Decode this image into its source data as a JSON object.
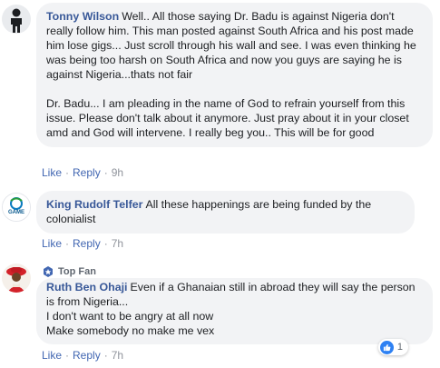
{
  "comments": [
    {
      "author": "Tonny Wilson",
      "paragraphs": [
        "Well.. All those saying Dr. Badu is against Nigeria don't really follow him. This man posted against South Africa and his post made him lose gigs... Just scroll through his wall and see. I was even thinking he was being too harsh on South Africa and now you guys are saying he is against Nigeria...thats not fair",
        "Dr. Badu... I am pleading in the name of God to refrain yourself from this issue. Please don't talk about it anymore. Just pray about it in your closet amd and God will intervene. I really beg you.. This will be for good"
      ],
      "like_label": "Like",
      "reply_label": "Reply",
      "time": "9h"
    },
    {
      "author": "King Rudolf Telfer",
      "paragraphs": [
        "All these happenings are being funded by the colonialist"
      ],
      "like_label": "Like",
      "reply_label": "Reply",
      "time": "7h",
      "avatar_text": "GAME"
    },
    {
      "badge": "Top Fan",
      "author": "Ruth Ben Ohaji",
      "lines": [
        "Even if a Ghanaian still in abroad they will say the person is from Nigeria...",
        "I don't want to be angry at all now",
        "Make somebody no make me vex"
      ],
      "like_label": "Like",
      "reply_label": "Reply",
      "time": "7h",
      "reaction_count": "1"
    }
  ],
  "colors": {
    "link": "#385898",
    "bubble": "#f2f3f5",
    "like_blue": "#2e81f3"
  },
  "icons": [
    "avatar-silhouette",
    "game-logo",
    "avatar-woman-red-hat",
    "top-fan-badge-icon",
    "like-reaction-icon"
  ]
}
